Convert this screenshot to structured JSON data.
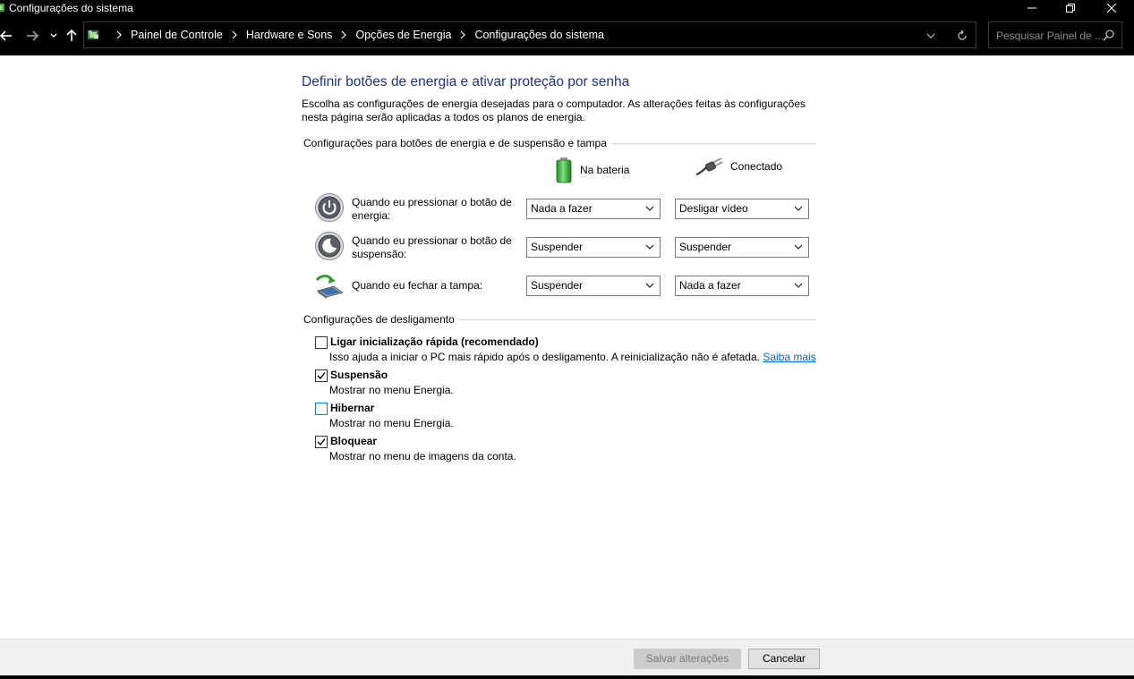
{
  "window": {
    "title": "Configurações do sistema"
  },
  "address_bar": {
    "breadcrumbs": [
      "Painel de Controle",
      "Hardware e Sons",
      "Opções de Energia",
      "Configurações do sistema"
    ],
    "search_placeholder": "Pesquisar Painel de ..."
  },
  "page": {
    "heading": "Definir botões de energia e ativar proteção por senha",
    "intro": "Escolha as configurações de energia desejadas para o computador. As alterações feitas às configurações nesta página serão aplicadas a todos os planos de energia."
  },
  "power_buttons": {
    "group_title": "Configurações para botões de energia e de suspensão e tampa",
    "columns": {
      "battery": "Na bateria",
      "plugged": "Conectado"
    },
    "rows": [
      {
        "label": "Quando eu pressionar o botão de energia:",
        "battery": "Nada a fazer",
        "plugged": "Desligar vídeo",
        "icon": "power-button-icon"
      },
      {
        "label": "Quando eu pressionar o botão de suspensão:",
        "battery": "Suspender",
        "plugged": "Suspender",
        "icon": "sleep-button-icon"
      },
      {
        "label": "Quando eu fechar a tampa:",
        "battery": "Suspender",
        "plugged": "Nada a fazer",
        "icon": "laptop-lid-icon"
      }
    ]
  },
  "shutdown": {
    "group_title": "Configurações de desligamento",
    "options": [
      {
        "label": "Ligar inicialização rápida (recomendado)",
        "desc": "Isso ajuda a iniciar o PC mais rápido após o desligamento. A reinicialização não é afetada.",
        "link": "Saiba mais",
        "checked": false
      },
      {
        "label": "Suspensão",
        "desc": "Mostrar no menu Energia.",
        "checked": true
      },
      {
        "label": "Hibernar",
        "desc": "Mostrar no menu Energia.",
        "checked": false
      },
      {
        "label": "Bloquear",
        "desc": "Mostrar no menu de imagens da conta.",
        "checked": true
      }
    ]
  },
  "footer": {
    "save_label": "Salvar alterações",
    "cancel_label": "Cancelar"
  },
  "colors": {
    "heading": "#1e3287",
    "link": "#0066cc",
    "titlebar": "#000000"
  }
}
